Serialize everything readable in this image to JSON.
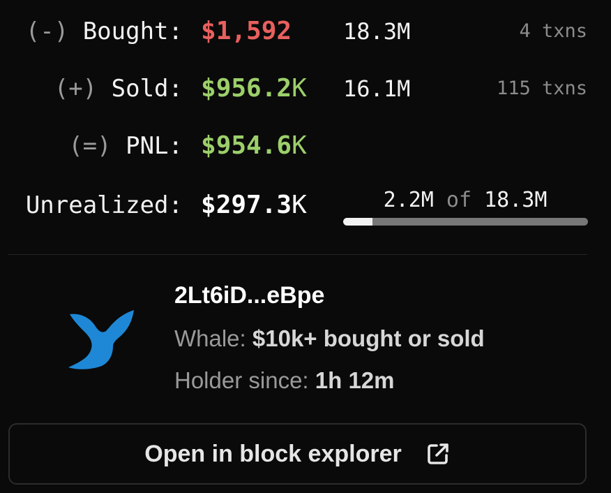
{
  "stats": {
    "bought": {
      "sign": "(-)",
      "label": "Bought:",
      "currency": "$",
      "value": "1,592",
      "unit": "",
      "quantity": "18.3M",
      "txns": "4 txns",
      "color": "#e8605e"
    },
    "sold": {
      "sign": "(+)",
      "label": "Sold:",
      "currency": "$",
      "value": "956.2",
      "unit": "K",
      "quantity": "16.1M",
      "txns": "115 txns",
      "color": "#9ccf6a"
    },
    "pnl": {
      "sign": "(=)",
      "label": "PNL:",
      "currency": "$",
      "value": "954.6",
      "unit": "K",
      "color": "#9ccf6a"
    },
    "unrealized": {
      "label": "Unrealized:",
      "currency": "$",
      "value": "297.3",
      "unit": "K",
      "color": "#ffffff"
    }
  },
  "holding": {
    "held": "2.2M",
    "of": "of",
    "total": "18.3M",
    "fraction": 0.12
  },
  "wallet": {
    "address": "2Lt6iD...eBpe",
    "whale_prefix": "Whale:",
    "whale_value": "$10k+ bought or sold",
    "holder_prefix": "Holder since:",
    "holder_value": "1h 12m",
    "icon": "whale-tail-icon",
    "icon_color": "#1e88d6"
  },
  "actions": {
    "explorer_label": "Open in block explorer",
    "explorer_icon": "external-link-icon"
  }
}
